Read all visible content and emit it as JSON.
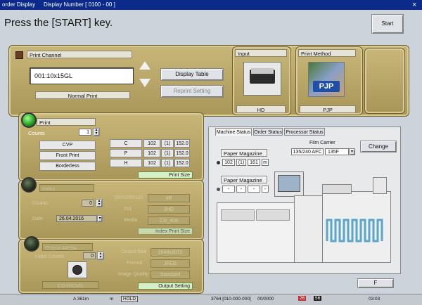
{
  "titlebar": {
    "left": "order Display",
    "center": "Display Number [ 0100 - 00 ]",
    "close": "×"
  },
  "prompt": "Press the [START] key.",
  "start_label": "Start",
  "print_channel": {
    "label": "Print Channel",
    "value": "001:10x15GL",
    "mode": "Normal Print",
    "display_table": "Display Table",
    "reprint_setting": "Reprint Setting"
  },
  "input": {
    "label": "Input",
    "value": "HD"
  },
  "print_method": {
    "label": "Print Method",
    "value": "PJP",
    "logo_text": "PJP"
  },
  "print": {
    "label": "Print",
    "counts_label": "Counts",
    "counts_value": "1",
    "options": [
      "CVP",
      "Front Print",
      "Borderless"
    ],
    "rows": [
      {
        "k": "C",
        "a": "102",
        "b": "(1)",
        "c": "152.0"
      },
      {
        "k": "P",
        "a": "102",
        "b": "(1)",
        "c": "152.0"
      },
      {
        "k": "H",
        "a": "102",
        "b": "(1)",
        "c": "152.0"
      }
    ],
    "size_tag": "Print Size"
  },
  "index": {
    "label": "Index",
    "counts_label": "Counts",
    "counts_value": "0",
    "date_label": "Date",
    "date_value": "26.04.2016",
    "size_label": "150X200/110",
    "size_value": "4R",
    "res_label": "2x3",
    "res_value": "3HD",
    "media_label": "Media",
    "media_value": "CD_408",
    "tag": "Index Print Size"
  },
  "output_media": {
    "label": "Output Media",
    "label_counts": "Label Counts",
    "label_counts_value": "0",
    "media_type": "CD-R/DVD",
    "output_size_label": "Output Size",
    "output_size_value": "2048x3072",
    "format_label": "Format",
    "format_value": "JPEG",
    "quality_label": "Image Quality",
    "quality_value": "Standard",
    "tag": "Output Setting"
  },
  "status_tabs": [
    "Machine Status",
    "Order Status",
    "Processor Status"
  ],
  "machine": {
    "mag_a_label": "Paper Magazine A",
    "mag_a": [
      "102",
      "(1)",
      "161",
      "m"
    ],
    "mag_b_label": "Paper Magazine B",
    "mag_b": [
      "-",
      "-",
      "-",
      "-"
    ],
    "film_carrier_label": "Film Carrier",
    "film_carrier_value": "135/240 AFC",
    "film_select": "135F",
    "change": "Change"
  },
  "f_key": "F",
  "statusbar": {
    "left1": "A 361m",
    "left2": "m",
    "hold": "HOLD",
    "code": "3764 [010-000-000]",
    "order": "00/0000",
    "c1": "26",
    "c2": "56",
    "time": "03:03"
  }
}
